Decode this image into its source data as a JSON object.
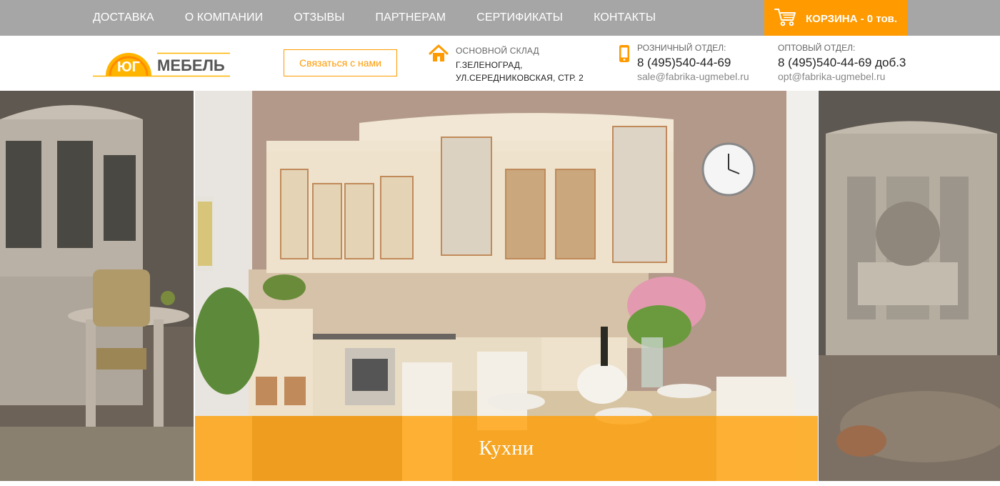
{
  "nav": {
    "items": [
      "ДОСТАВКА",
      "О КОМПАНИИ",
      "ОТЗЫВЫ",
      "ПАРТНЕРАМ",
      "СЕРТИФИКАТЫ",
      "КОНТАКТЫ"
    ]
  },
  "cart": {
    "label": "КОРЗИНА - 0 тов.",
    "icon": "cart-icon"
  },
  "logo": {
    "part1": "ЮГ",
    "part2": "МЕБЕЛЬ"
  },
  "contact_button": "Связаться с нами",
  "warehouse": {
    "label": "ОСНОВНОЙ СКЛАД",
    "line1": "Г.ЗЕЛЕНОГРАД,",
    "line2": "УЛ.СЕРЕДНИКОВСКАЯ, СТР. 2",
    "icon": "home-icon"
  },
  "retail": {
    "label": "РОЗНИЧНЫЙ ОТДЕЛ:",
    "phone": "8 (495)540-44-69",
    "email": "sale@fabrika-ugmebel.ru",
    "icon": "phone-icon"
  },
  "wholesale": {
    "label": "ОПТОВЫЙ ОТДЕЛ:",
    "phone": "8 (495)540-44-69 доб.3",
    "email": "opt@fabrika-ugmebel.ru"
  },
  "slider": {
    "active_caption": "Кухни"
  },
  "colors": {
    "accent": "#ff9a00",
    "topbar": "#a6a6a6"
  }
}
